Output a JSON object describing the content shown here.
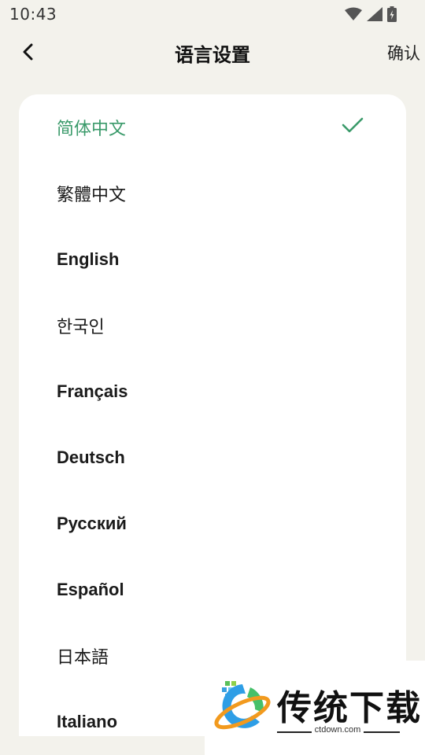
{
  "status_bar": {
    "time": "10:43"
  },
  "header": {
    "title": "语言设置",
    "confirm_label": "确认"
  },
  "languages": [
    {
      "label": "简体中文",
      "selected": true
    },
    {
      "label": "繁體中文",
      "selected": false
    },
    {
      "label": "English",
      "selected": false
    },
    {
      "label": "한국인",
      "selected": false
    },
    {
      "label": "Français",
      "selected": false
    },
    {
      "label": "Deutsch",
      "selected": false
    },
    {
      "label": "Русский",
      "selected": false
    },
    {
      "label": "Español",
      "selected": false
    },
    {
      "label": "日本語",
      "selected": false
    },
    {
      "label": "Italiano",
      "selected": false
    }
  ],
  "colors": {
    "accent": "#3a9a6a",
    "background": "#f3f2ec",
    "card": "#ffffff"
  },
  "icons": {
    "back": "chevron-left-icon",
    "selected": "check-icon"
  },
  "watermark": {
    "text": "传统下载",
    "domain": "ctdown.com"
  }
}
